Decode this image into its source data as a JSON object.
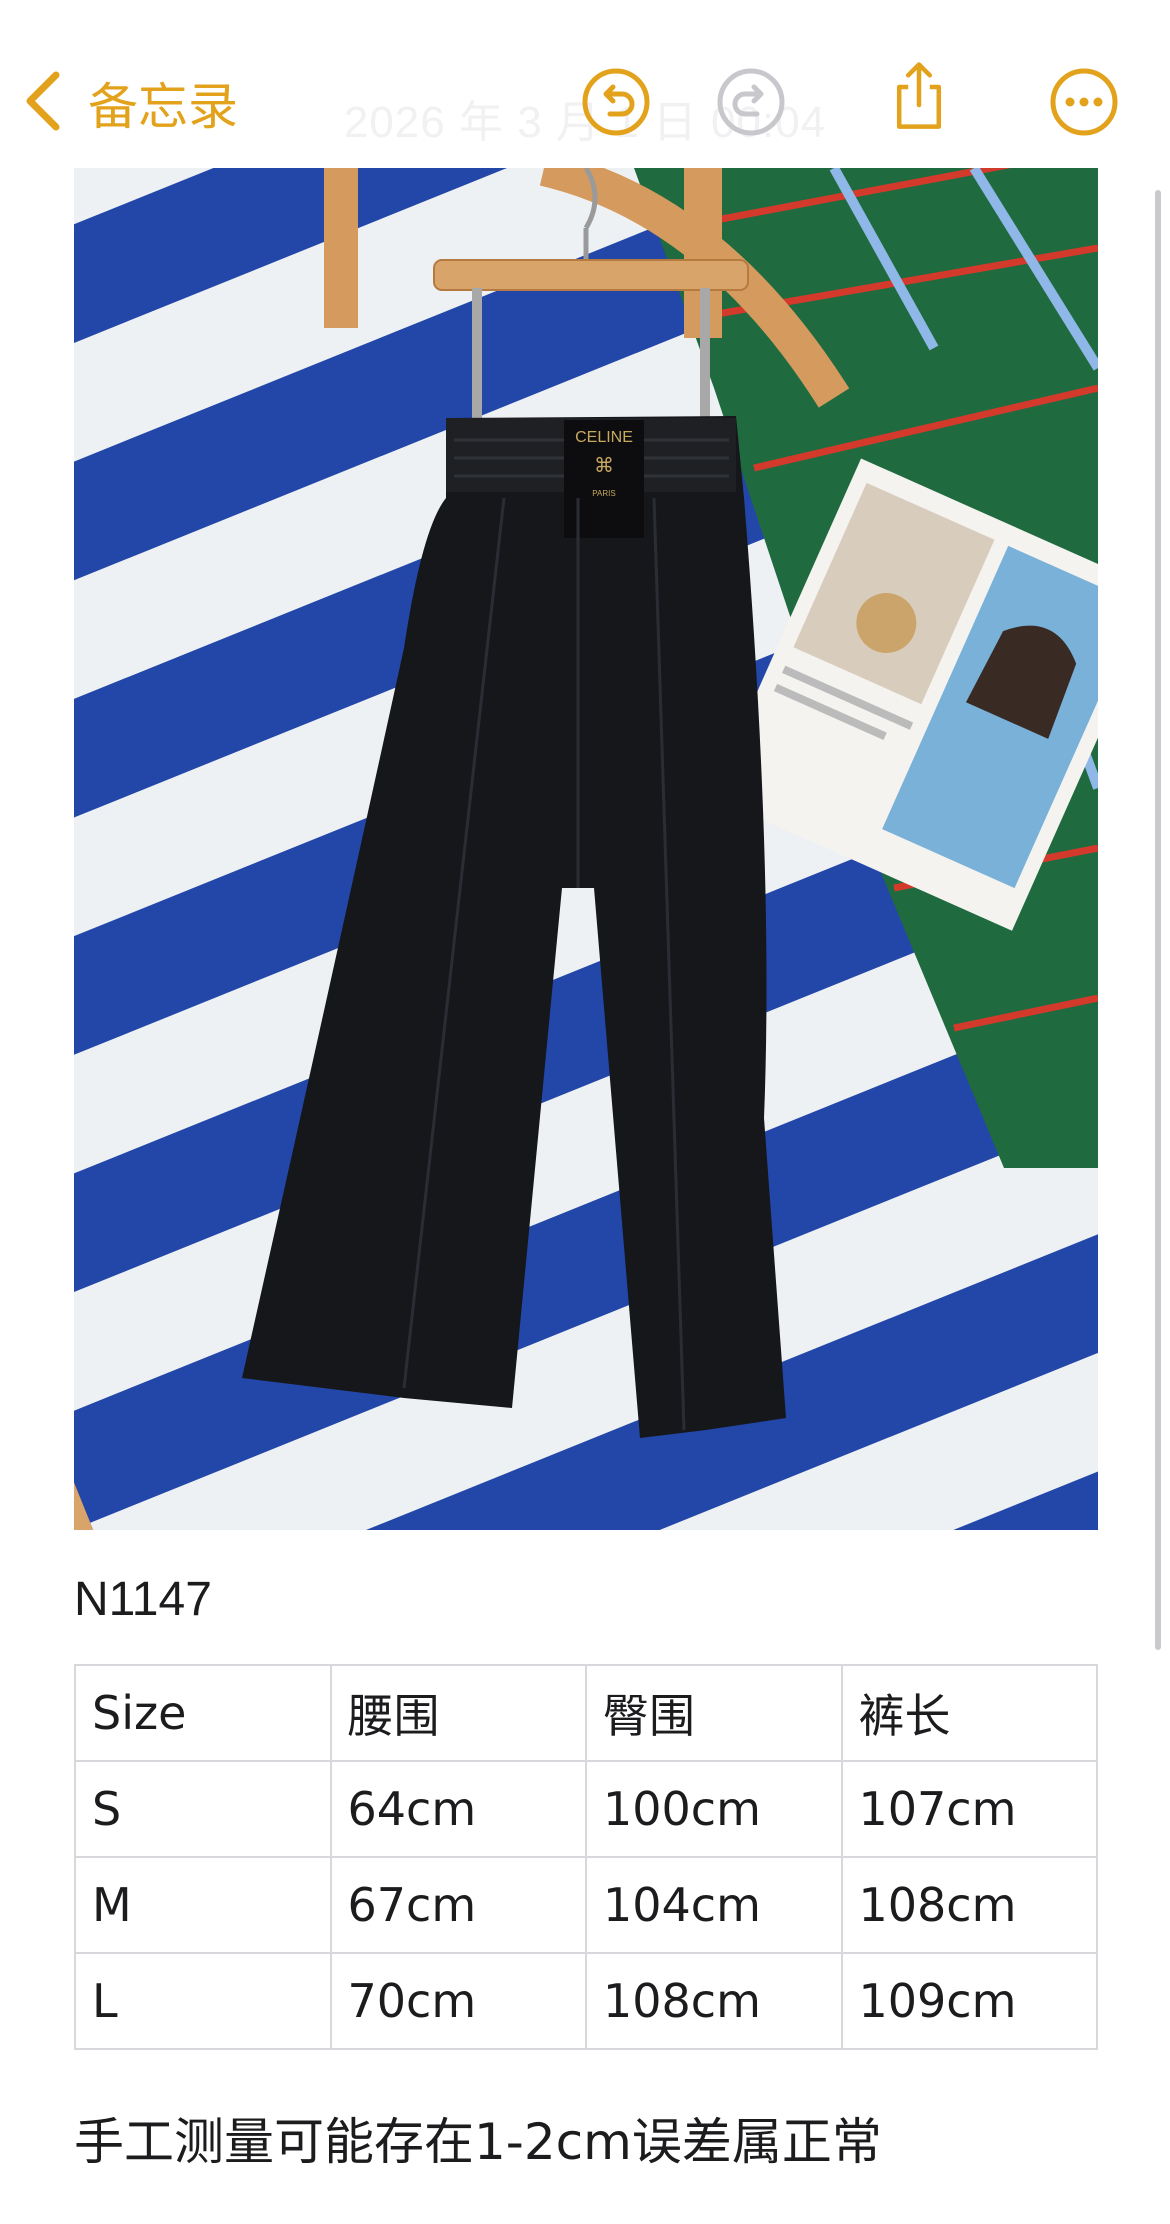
{
  "nav": {
    "back_label": "备忘录",
    "date_faint": "2026 年 3 月 1 日 00:04"
  },
  "colors": {
    "accent": "#e3a21b",
    "text": "#1c1c1e",
    "table_border": "#d8d8dc"
  },
  "icons": {
    "back": "chevron-left-icon",
    "undo": "undo-icon",
    "redo": "redo-icon",
    "share": "share-icon",
    "more": "more-icon"
  },
  "photo": {
    "label_brand": "CELINE",
    "label_city": "PARIS"
  },
  "note_body": {
    "model_code": "N1147",
    "table": {
      "headers": [
        "Size",
        "腰围",
        "臀围",
        "裤长"
      ],
      "rows": [
        [
          "S",
          "64cm",
          "100cm",
          "107cm"
        ],
        [
          "M",
          "67cm",
          "104cm",
          "108cm"
        ],
        [
          "L",
          "70cm",
          "108cm",
          "109cm"
        ]
      ]
    },
    "footnote": "手工测量可能存在1-2cm误差属正常"
  }
}
